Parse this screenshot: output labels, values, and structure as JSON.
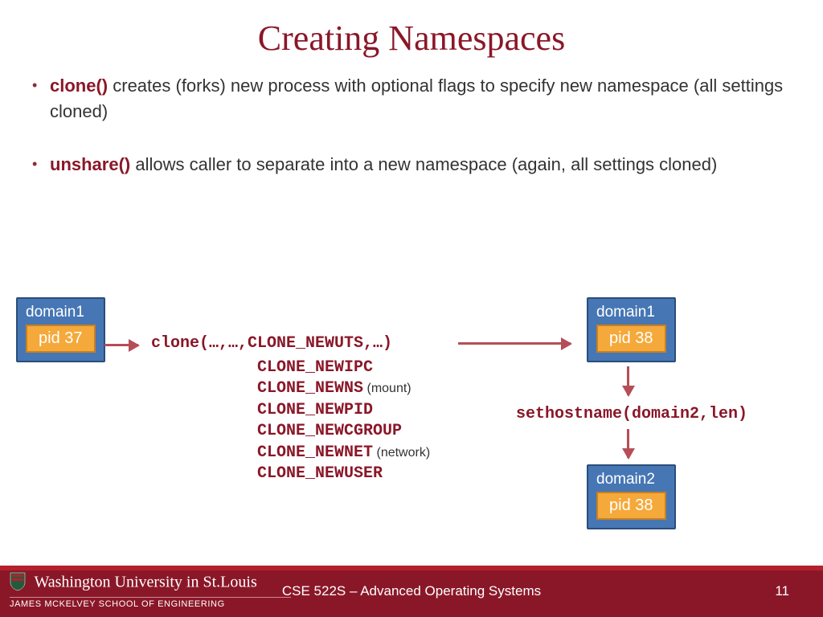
{
  "title": "Creating Namespaces",
  "bullets": [
    {
      "kw": "clone()",
      "text": " creates (forks) new process with optional flags to specify new namespace (all settings cloned)"
    },
    {
      "kw": "unshare()",
      "text": " allows caller to separate into a new namespace (again, all settings cloned)"
    }
  ],
  "diagram": {
    "box1": {
      "domain": "domain1",
      "pid": "pid 37"
    },
    "box2": {
      "domain": "domain1",
      "pid": "pid 38"
    },
    "box3": {
      "domain": "domain2",
      "pid": "pid 38"
    },
    "clone_call": "clone(…,…,CLONE_NEWUTS,…)",
    "flags": [
      {
        "name": "CLONE_NEWIPC",
        "note": ""
      },
      {
        "name": "CLONE_NEWNS",
        "note": "(mount)"
      },
      {
        "name": "CLONE_NEWPID",
        "note": ""
      },
      {
        "name": "CLONE_NEWCGROUP",
        "note": ""
      },
      {
        "name": "CLONE_NEWNET",
        "note": "(network)"
      },
      {
        "name": "CLONE_NEWUSER",
        "note": ""
      }
    ],
    "sethost": "sethostname(domain2,len)"
  },
  "footer": {
    "uni": "Washington University in St.Louis",
    "school": "JAMES MCKELVEY SCHOOL OF ENGINEERING",
    "course": "CSE 522S – Advanced Operating Systems",
    "page": "11"
  }
}
